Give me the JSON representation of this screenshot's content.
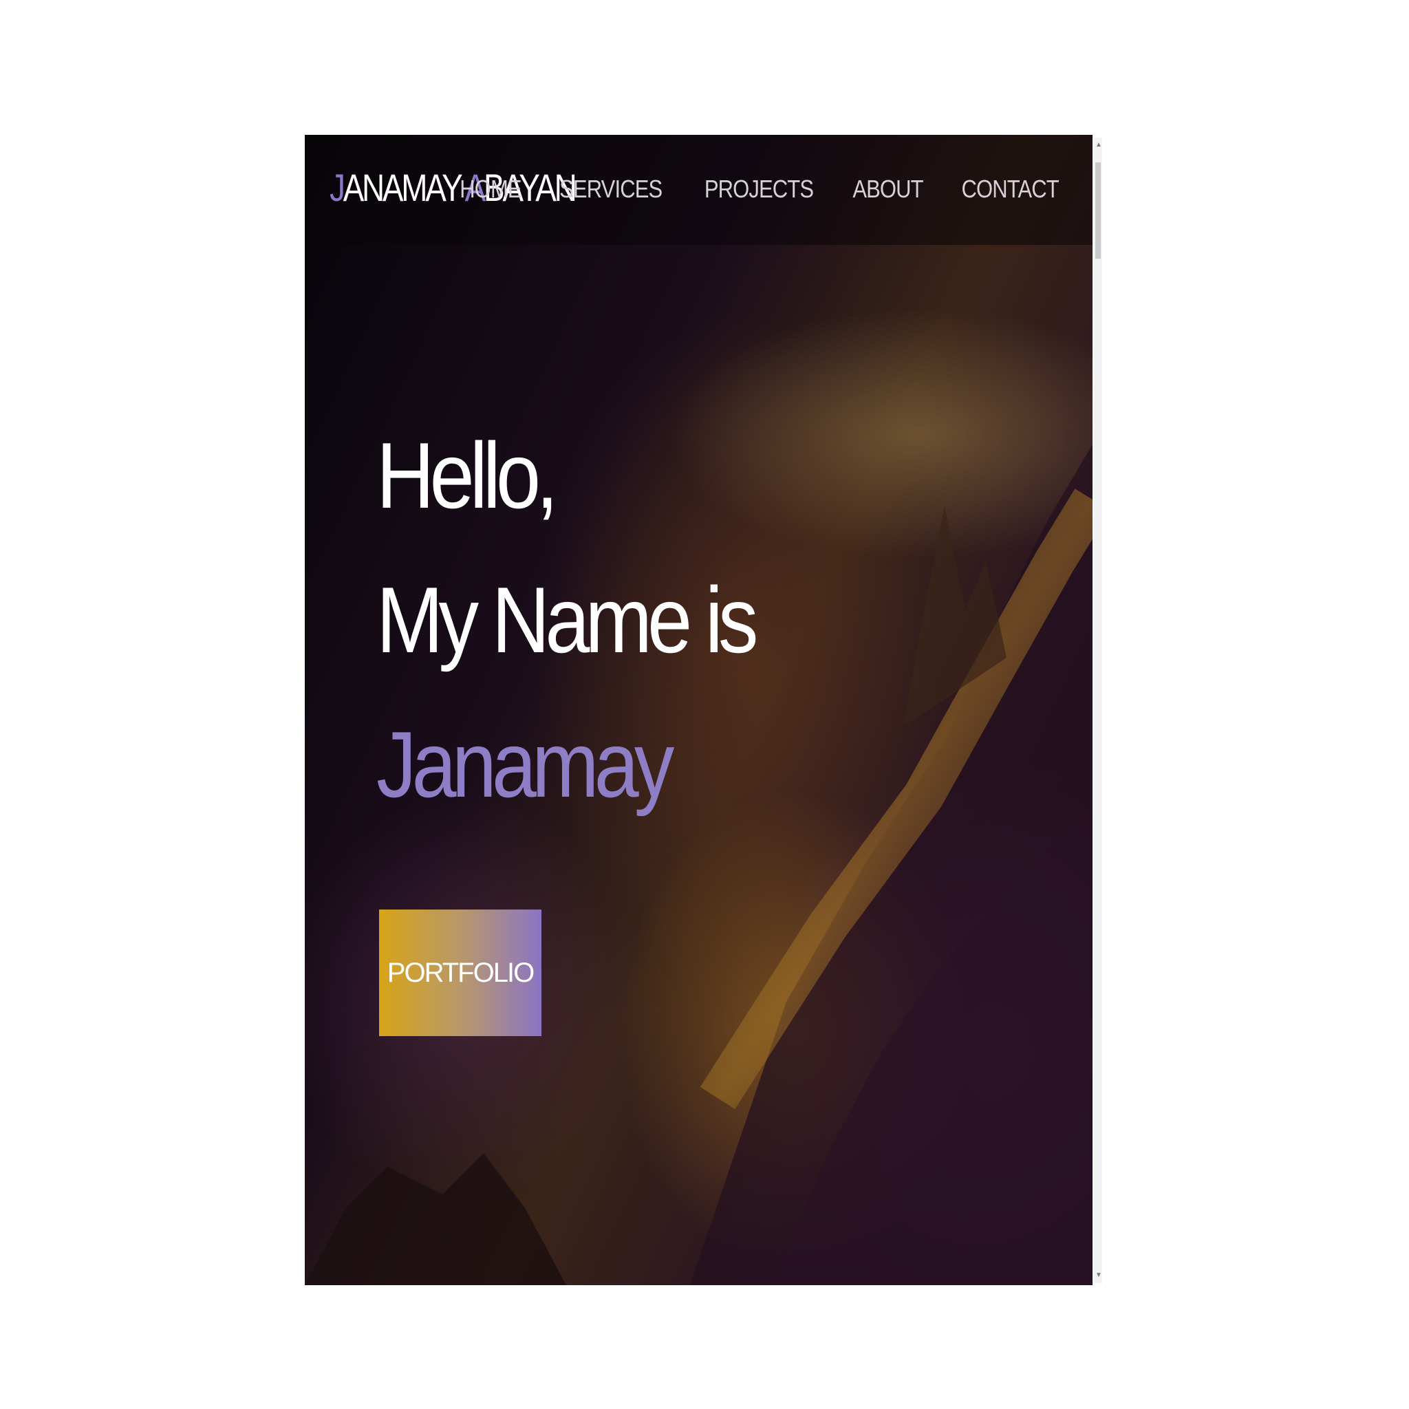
{
  "brand": {
    "first_initial": "J",
    "first_rest": "ANAMAY ",
    "last_initial": "A",
    "last_rest": "BAYAN"
  },
  "nav": {
    "items": [
      {
        "label": "HOME"
      },
      {
        "label": "SERVICES"
      },
      {
        "label": "PROJECTS"
      },
      {
        "label": "ABOUT"
      },
      {
        "label": "CONTACT"
      }
    ]
  },
  "hero": {
    "greeting": "Hello,",
    "intro": "My Name is",
    "name": "Janamay",
    "cta_label": "PORTFOLIO"
  },
  "colors": {
    "accent": "#8a78c8",
    "button_gradient_start": "#d7a417",
    "button_gradient_end": "#8b75c4"
  },
  "scrollbar": {
    "up_icon": "arrow-up-icon",
    "down_icon": "arrow-down-icon"
  }
}
